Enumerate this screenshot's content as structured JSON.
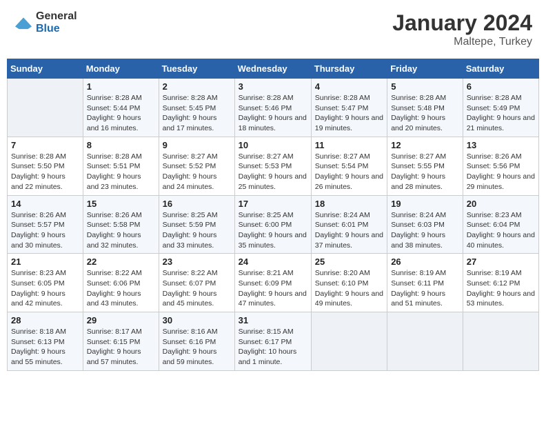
{
  "logo": {
    "general": "General",
    "blue": "Blue"
  },
  "title": {
    "month_year": "January 2024",
    "location": "Maltepe, Turkey"
  },
  "header_days": [
    "Sunday",
    "Monday",
    "Tuesday",
    "Wednesday",
    "Thursday",
    "Friday",
    "Saturday"
  ],
  "weeks": [
    [
      {
        "date": "",
        "sunrise": "",
        "sunset": "",
        "daylight": ""
      },
      {
        "date": "1",
        "sunrise": "Sunrise: 8:28 AM",
        "sunset": "Sunset: 5:44 PM",
        "daylight": "Daylight: 9 hours and 16 minutes."
      },
      {
        "date": "2",
        "sunrise": "Sunrise: 8:28 AM",
        "sunset": "Sunset: 5:45 PM",
        "daylight": "Daylight: 9 hours and 17 minutes."
      },
      {
        "date": "3",
        "sunrise": "Sunrise: 8:28 AM",
        "sunset": "Sunset: 5:46 PM",
        "daylight": "Daylight: 9 hours and 18 minutes."
      },
      {
        "date": "4",
        "sunrise": "Sunrise: 8:28 AM",
        "sunset": "Sunset: 5:47 PM",
        "daylight": "Daylight: 9 hours and 19 minutes."
      },
      {
        "date": "5",
        "sunrise": "Sunrise: 8:28 AM",
        "sunset": "Sunset: 5:48 PM",
        "daylight": "Daylight: 9 hours and 20 minutes."
      },
      {
        "date": "6",
        "sunrise": "Sunrise: 8:28 AM",
        "sunset": "Sunset: 5:49 PM",
        "daylight": "Daylight: 9 hours and 21 minutes."
      }
    ],
    [
      {
        "date": "7",
        "sunrise": "Sunrise: 8:28 AM",
        "sunset": "Sunset: 5:50 PM",
        "daylight": "Daylight: 9 hours and 22 minutes."
      },
      {
        "date": "8",
        "sunrise": "Sunrise: 8:28 AM",
        "sunset": "Sunset: 5:51 PM",
        "daylight": "Daylight: 9 hours and 23 minutes."
      },
      {
        "date": "9",
        "sunrise": "Sunrise: 8:27 AM",
        "sunset": "Sunset: 5:52 PM",
        "daylight": "Daylight: 9 hours and 24 minutes."
      },
      {
        "date": "10",
        "sunrise": "Sunrise: 8:27 AM",
        "sunset": "Sunset: 5:53 PM",
        "daylight": "Daylight: 9 hours and 25 minutes."
      },
      {
        "date": "11",
        "sunrise": "Sunrise: 8:27 AM",
        "sunset": "Sunset: 5:54 PM",
        "daylight": "Daylight: 9 hours and 26 minutes."
      },
      {
        "date": "12",
        "sunrise": "Sunrise: 8:27 AM",
        "sunset": "Sunset: 5:55 PM",
        "daylight": "Daylight: 9 hours and 28 minutes."
      },
      {
        "date": "13",
        "sunrise": "Sunrise: 8:26 AM",
        "sunset": "Sunset: 5:56 PM",
        "daylight": "Daylight: 9 hours and 29 minutes."
      }
    ],
    [
      {
        "date": "14",
        "sunrise": "Sunrise: 8:26 AM",
        "sunset": "Sunset: 5:57 PM",
        "daylight": "Daylight: 9 hours and 30 minutes."
      },
      {
        "date": "15",
        "sunrise": "Sunrise: 8:26 AM",
        "sunset": "Sunset: 5:58 PM",
        "daylight": "Daylight: 9 hours and 32 minutes."
      },
      {
        "date": "16",
        "sunrise": "Sunrise: 8:25 AM",
        "sunset": "Sunset: 5:59 PM",
        "daylight": "Daylight: 9 hours and 33 minutes."
      },
      {
        "date": "17",
        "sunrise": "Sunrise: 8:25 AM",
        "sunset": "Sunset: 6:00 PM",
        "daylight": "Daylight: 9 hours and 35 minutes."
      },
      {
        "date": "18",
        "sunrise": "Sunrise: 8:24 AM",
        "sunset": "Sunset: 6:01 PM",
        "daylight": "Daylight: 9 hours and 37 minutes."
      },
      {
        "date": "19",
        "sunrise": "Sunrise: 8:24 AM",
        "sunset": "Sunset: 6:03 PM",
        "daylight": "Daylight: 9 hours and 38 minutes."
      },
      {
        "date": "20",
        "sunrise": "Sunrise: 8:23 AM",
        "sunset": "Sunset: 6:04 PM",
        "daylight": "Daylight: 9 hours and 40 minutes."
      }
    ],
    [
      {
        "date": "21",
        "sunrise": "Sunrise: 8:23 AM",
        "sunset": "Sunset: 6:05 PM",
        "daylight": "Daylight: 9 hours and 42 minutes."
      },
      {
        "date": "22",
        "sunrise": "Sunrise: 8:22 AM",
        "sunset": "Sunset: 6:06 PM",
        "daylight": "Daylight: 9 hours and 43 minutes."
      },
      {
        "date": "23",
        "sunrise": "Sunrise: 8:22 AM",
        "sunset": "Sunset: 6:07 PM",
        "daylight": "Daylight: 9 hours and 45 minutes."
      },
      {
        "date": "24",
        "sunrise": "Sunrise: 8:21 AM",
        "sunset": "Sunset: 6:09 PM",
        "daylight": "Daylight: 9 hours and 47 minutes."
      },
      {
        "date": "25",
        "sunrise": "Sunrise: 8:20 AM",
        "sunset": "Sunset: 6:10 PM",
        "daylight": "Daylight: 9 hours and 49 minutes."
      },
      {
        "date": "26",
        "sunrise": "Sunrise: 8:19 AM",
        "sunset": "Sunset: 6:11 PM",
        "daylight": "Daylight: 9 hours and 51 minutes."
      },
      {
        "date": "27",
        "sunrise": "Sunrise: 8:19 AM",
        "sunset": "Sunset: 6:12 PM",
        "daylight": "Daylight: 9 hours and 53 minutes."
      }
    ],
    [
      {
        "date": "28",
        "sunrise": "Sunrise: 8:18 AM",
        "sunset": "Sunset: 6:13 PM",
        "daylight": "Daylight: 9 hours and 55 minutes."
      },
      {
        "date": "29",
        "sunrise": "Sunrise: 8:17 AM",
        "sunset": "Sunset: 6:15 PM",
        "daylight": "Daylight: 9 hours and 57 minutes."
      },
      {
        "date": "30",
        "sunrise": "Sunrise: 8:16 AM",
        "sunset": "Sunset: 6:16 PM",
        "daylight": "Daylight: 9 hours and 59 minutes."
      },
      {
        "date": "31",
        "sunrise": "Sunrise: 8:15 AM",
        "sunset": "Sunset: 6:17 PM",
        "daylight": "Daylight: 10 hours and 1 minute."
      },
      {
        "date": "",
        "sunrise": "",
        "sunset": "",
        "daylight": ""
      },
      {
        "date": "",
        "sunrise": "",
        "sunset": "",
        "daylight": ""
      },
      {
        "date": "",
        "sunrise": "",
        "sunset": "",
        "daylight": ""
      }
    ]
  ]
}
